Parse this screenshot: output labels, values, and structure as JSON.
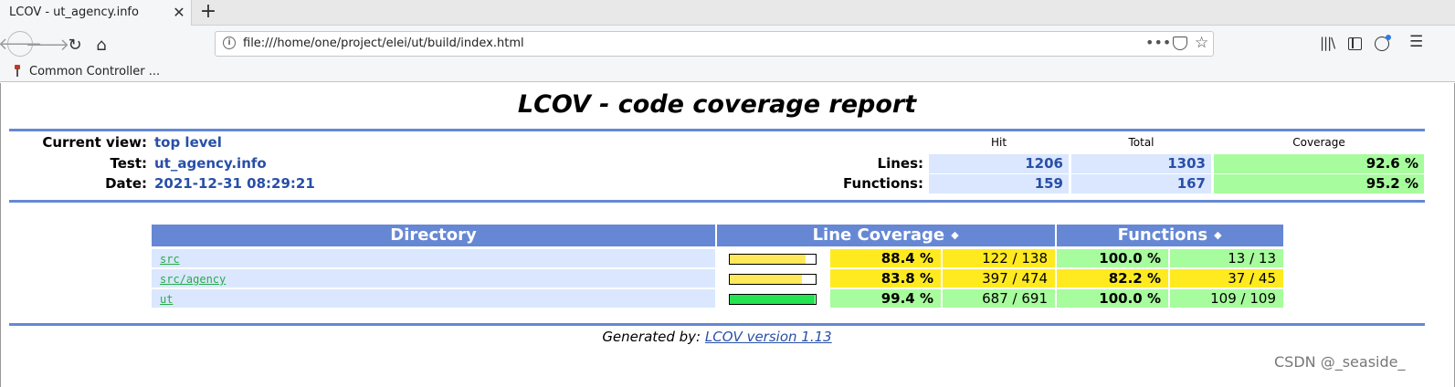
{
  "browser": {
    "tab_title": "LCOV - ut_agency.info",
    "tab_close": "✕",
    "new_tab": "+",
    "url": "file:///home/one/project/elei/ut/build/index.html",
    "bookmark_label": "Common Controller ..."
  },
  "report": {
    "title": "LCOV - code coverage report",
    "current_view_label": "Current view:",
    "current_view": "top level",
    "test_label": "Test:",
    "test": "ut_agency.info",
    "date_label": "Date:",
    "date": "2021-12-31 08:29:21"
  },
  "summary": {
    "headers": {
      "hit": "Hit",
      "total": "Total",
      "coverage": "Coverage"
    },
    "lines": {
      "label": "Lines:",
      "hit": "1206",
      "total": "1303",
      "coverage": "92.6 %"
    },
    "functions": {
      "label": "Functions:",
      "hit": "159",
      "total": "167",
      "coverage": "95.2 %"
    }
  },
  "table": {
    "headers": {
      "directory": "Directory",
      "line_coverage": "Line Coverage",
      "functions": "Functions",
      "sort_icon": "◆"
    },
    "rows": [
      {
        "name": "src",
        "line_pct": "88.4 %",
        "line_cnt": "122 / 138",
        "func_pct": "100.0 %",
        "func_cnt": "13 / 13",
        "bar_fraction": 0.884,
        "bar_color": "#ffe95a",
        "line_color": "#ffea20",
        "func_color": "#a7fc9d"
      },
      {
        "name": "src/agency",
        "line_pct": "83.8 %",
        "line_cnt": "397 / 474",
        "func_pct": "82.2 %",
        "func_cnt": "37 / 45",
        "bar_fraction": 0.838,
        "bar_color": "#ffe95a",
        "line_color": "#ffea20",
        "func_color": "#ffea20"
      },
      {
        "name": "ut",
        "line_pct": "99.4 %",
        "line_cnt": "687 / 691",
        "func_pct": "100.0 %",
        "func_cnt": "109 / 109",
        "bar_fraction": 0.994,
        "bar_color": "#23e450",
        "line_color": "#a7fc9d",
        "func_color": "#a7fc9d"
      }
    ]
  },
  "footer": {
    "prefix": "Generated by:",
    "link": "LCOV version 1.13"
  },
  "watermark": "CSDN @_seaside_",
  "colors": {
    "header_blue": "#6688d4",
    "cell_blue": "#dae7fe",
    "hi_green": "#a7fc9d",
    "med_yellow": "#ffea20"
  }
}
